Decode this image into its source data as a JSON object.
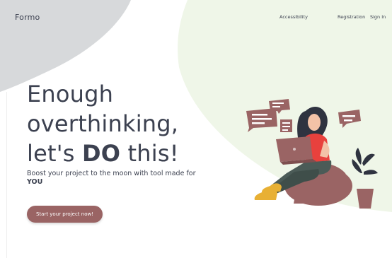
{
  "brand": "Formo",
  "nav": {
    "items": [
      "Accessibility",
      "Registration",
      "Sign In"
    ]
  },
  "hero": {
    "line1": "Enough",
    "line2": "overthinking,",
    "line3_a": "let's ",
    "line3_b": "DO",
    "line3_c": " this!",
    "subtitle_a": "Boost your project to the moon with tool made for ",
    "subtitle_b": "YOU",
    "cta": "Start your project now!"
  },
  "colors": {
    "accent": "#9a6464",
    "blob_grey": "#d7d9db",
    "blob_green": "#eff6e8",
    "text": "#3c4150"
  }
}
